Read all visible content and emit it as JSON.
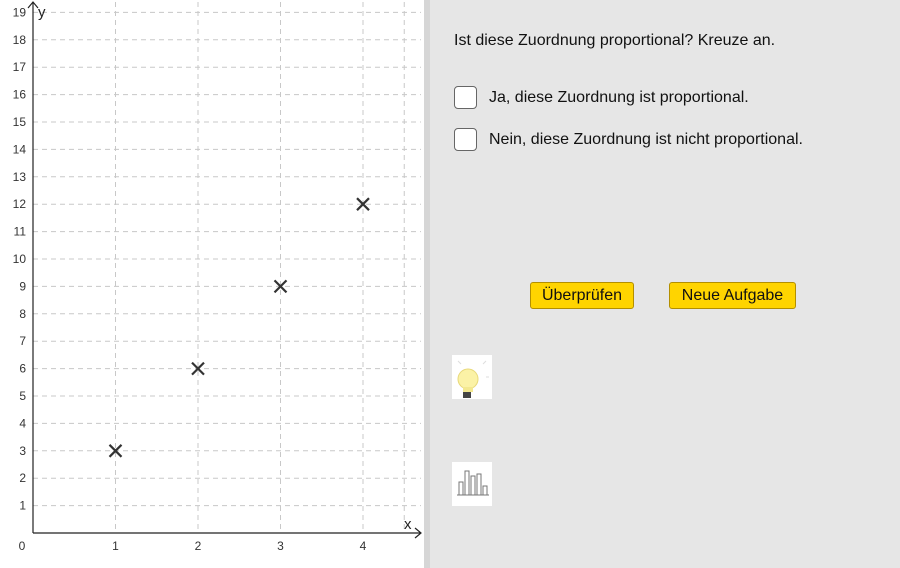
{
  "question": "Ist diese Zuordnung proportional? Kreuze an.",
  "options": [
    {
      "label": "Ja, diese Zuordnung ist proportional.",
      "checked": false
    },
    {
      "label": "Nein, diese Zuordnung ist nicht proportional.",
      "checked": false
    }
  ],
  "buttons": {
    "check": "Überprüfen",
    "new_task": "Neue Aufgabe"
  },
  "icons": {
    "hint": "lightbulb-icon",
    "stats": "bar-chart-icon"
  },
  "colors": {
    "button": "#ffd400",
    "panel": "#e6e6e6",
    "grid": "#c8c8c8",
    "point": "#333333"
  },
  "chart_data": {
    "type": "scatter",
    "x": [
      1,
      2,
      3,
      4
    ],
    "y": [
      3,
      6,
      9,
      12
    ],
    "xlabel": "x",
    "ylabel": "y",
    "xlim": [
      0,
      4.6
    ],
    "ylim": [
      0,
      19
    ],
    "xticks": [
      0,
      1,
      2,
      3,
      4
    ],
    "yticks": [
      1,
      2,
      3,
      4,
      5,
      6,
      7,
      8,
      9,
      10,
      11,
      12,
      13,
      14,
      15,
      16,
      17,
      18,
      19
    ],
    "grid": true,
    "marker": "x"
  }
}
